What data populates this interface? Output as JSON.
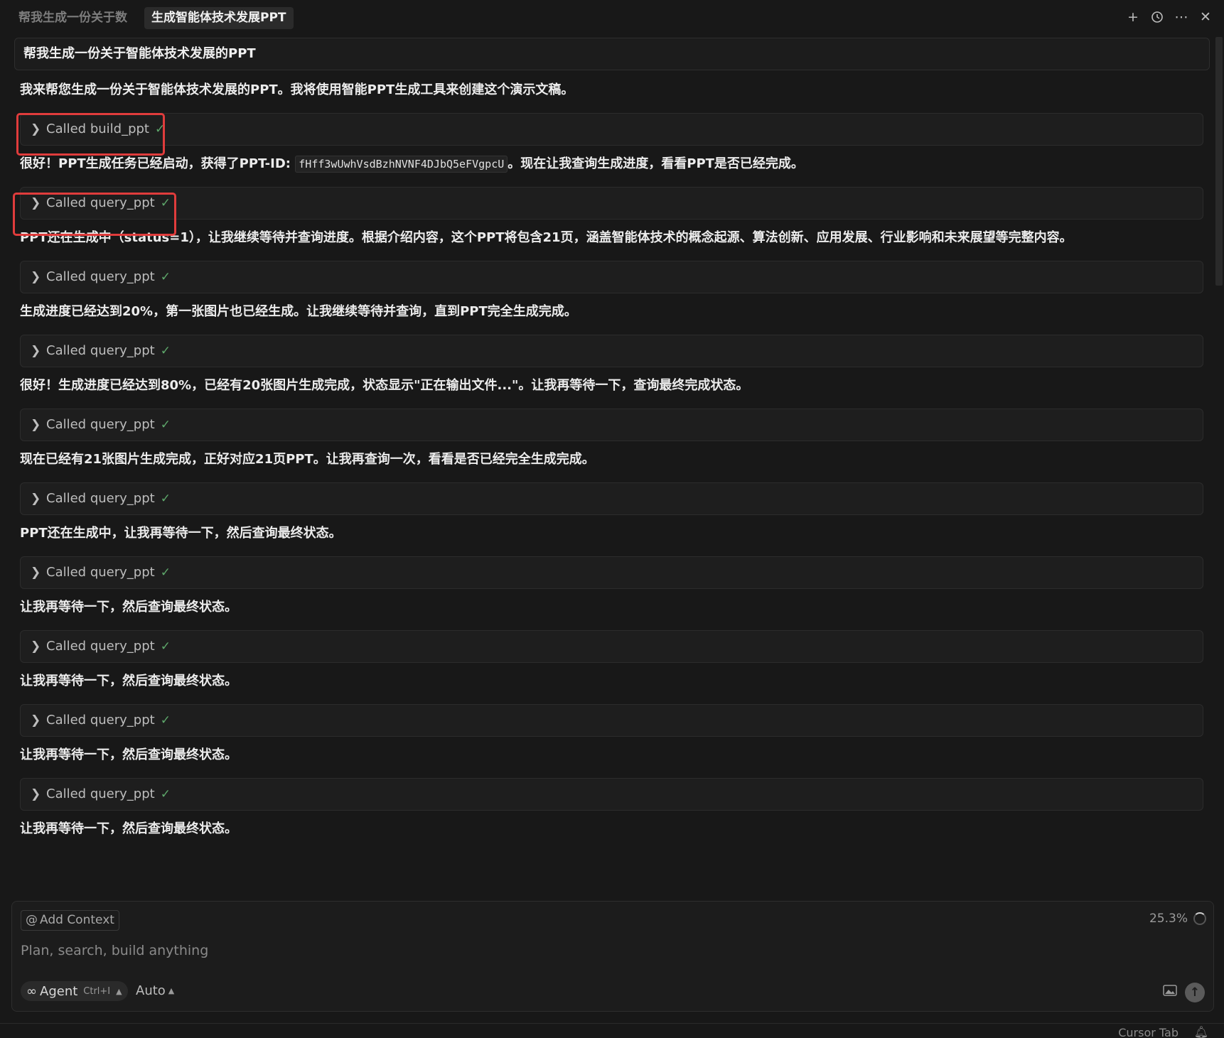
{
  "tabs": {
    "inactive_label": "帮我生成一份关于数",
    "active_label": "生成智能体技术发展PPT"
  },
  "tab_actions": {
    "new_icon": "plus-icon",
    "history_icon": "history-icon",
    "more_icon": "more-icon",
    "close_icon": "close-icon"
  },
  "user_message": "帮我生成一份关于智能体技术发展的PPT",
  "messages": {
    "m0": "我来帮您生成一份关于智能体技术发展的PPT。我将使用智能PPT生成工具来创建这个演示文稿。",
    "m1_before": "很好！PPT生成任务已经启动，获得了PPT-ID: ",
    "m1_code": "fHff3wUwhVsdBzhNVNF4DJbQ5eFVgpcU",
    "m1_after": "。现在让我查询生成进度，看看PPT是否已经完成。",
    "m2": "PPT还在生成中（status=1），让我继续等待并查询进度。根据介绍内容，这个PPT将包含21页，涵盖智能体技术的概念起源、算法创新、应用发展、行业影响和未来展望等完整内容。",
    "m3": "生成进度已经达到20%，第一张图片也已经生成。让我继续等待并查询，直到PPT完全生成完成。",
    "m4": "很好！生成进度已经达到80%，已经有20张图片生成完成，状态显示\"正在输出文件...\"。让我再等待一下，查询最终完成状态。",
    "m5": "现在已经有21张图片生成完成，正好对应21页PPT。让我再查询一次，看看是否已经完全生成完成。",
    "m6": "PPT还在生成中，让我再等待一下，然后查询最终状态。",
    "m7": "让我再等待一下，然后查询最终状态。",
    "m8": "让我再等待一下，然后查询最终状态。",
    "m9": "让我再等待一下，然后查询最终状态。",
    "m10": "让我再等待一下，然后查询最终状态。"
  },
  "tool_calls": {
    "build": "Called build_ppt",
    "query": "Called query_ppt"
  },
  "composer": {
    "add_context": "Add Context",
    "usage": "25.3%",
    "placeholder": "Plan, search, build anything",
    "mode": "Agent",
    "mode_shortcut": "Ctrl+I",
    "model": "Auto"
  },
  "status_bar": {
    "text": "Cursor Tab"
  },
  "colors": {
    "background": "#181818",
    "highlight_box": "#e03c3c",
    "check": "#5ea86b"
  }
}
